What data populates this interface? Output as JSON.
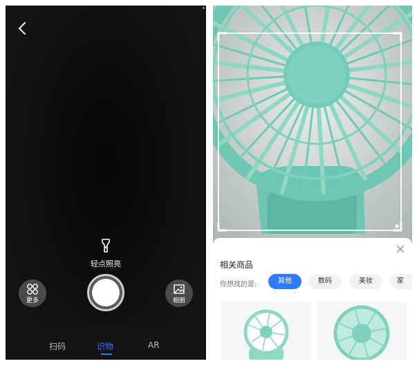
{
  "camera": {
    "flash_label": "轻点照亮",
    "more_label": "更多",
    "album_label": "相册",
    "modes": {
      "scan": "扫码",
      "recognize": "识物",
      "ar": "AR"
    },
    "active_mode": "识物"
  },
  "results": {
    "title": "相关商品",
    "question": "你想找的是:",
    "chips": [
      "其他",
      "数码",
      "美妆",
      "家"
    ],
    "selected_chip": "其他"
  },
  "colors": {
    "accent": "#2d7bff",
    "fan": "#7fd1bd"
  },
  "icons": [
    "back-chevron-icon",
    "flashlight-icon",
    "grid-icon",
    "image-icon",
    "close-icon"
  ]
}
